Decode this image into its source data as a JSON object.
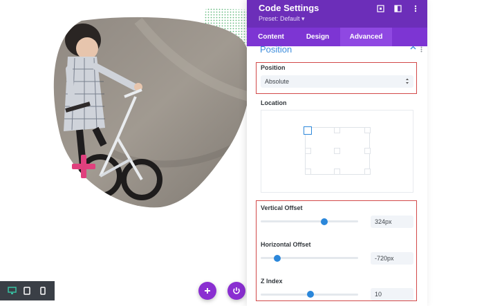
{
  "panel": {
    "title": "Code Settings",
    "preset": "Preset: Default ▾",
    "header_icons": [
      "target-icon",
      "sidebar-toggle-icon",
      "more-vertical-icon"
    ],
    "tabs": [
      {
        "label": "Content",
        "active": false
      },
      {
        "label": "Design",
        "active": false
      },
      {
        "label": "Advanced",
        "active": true
      }
    ],
    "section_title": "Position",
    "position_field": {
      "label": "Position",
      "value": "Absolute"
    },
    "location_field": {
      "label": "Location",
      "selected": "top-left"
    },
    "vertical_offset": {
      "label": "Vertical Offset",
      "value": "324px",
      "slider_fraction": 0.65
    },
    "horizontal_offset": {
      "label": "Horizontal Offset",
      "value": "-720px",
      "slider_fraction": 0.17
    },
    "z_index": {
      "label": "Z Index",
      "value": "10",
      "slider_fraction": 0.51
    }
  },
  "canvas": {
    "image_subject": "child on bicycle",
    "device_modes": [
      "desktop-icon",
      "tablet-icon",
      "phone-icon"
    ],
    "active_device": "desktop-icon"
  },
  "colors": {
    "header": "#6c2eb9",
    "tabs": "#7d35d3",
    "accent_blue": "#2b87da",
    "highlight_red": "#d24848",
    "plus_pink": "#e0407d",
    "dots_green": "#4caf6a"
  }
}
